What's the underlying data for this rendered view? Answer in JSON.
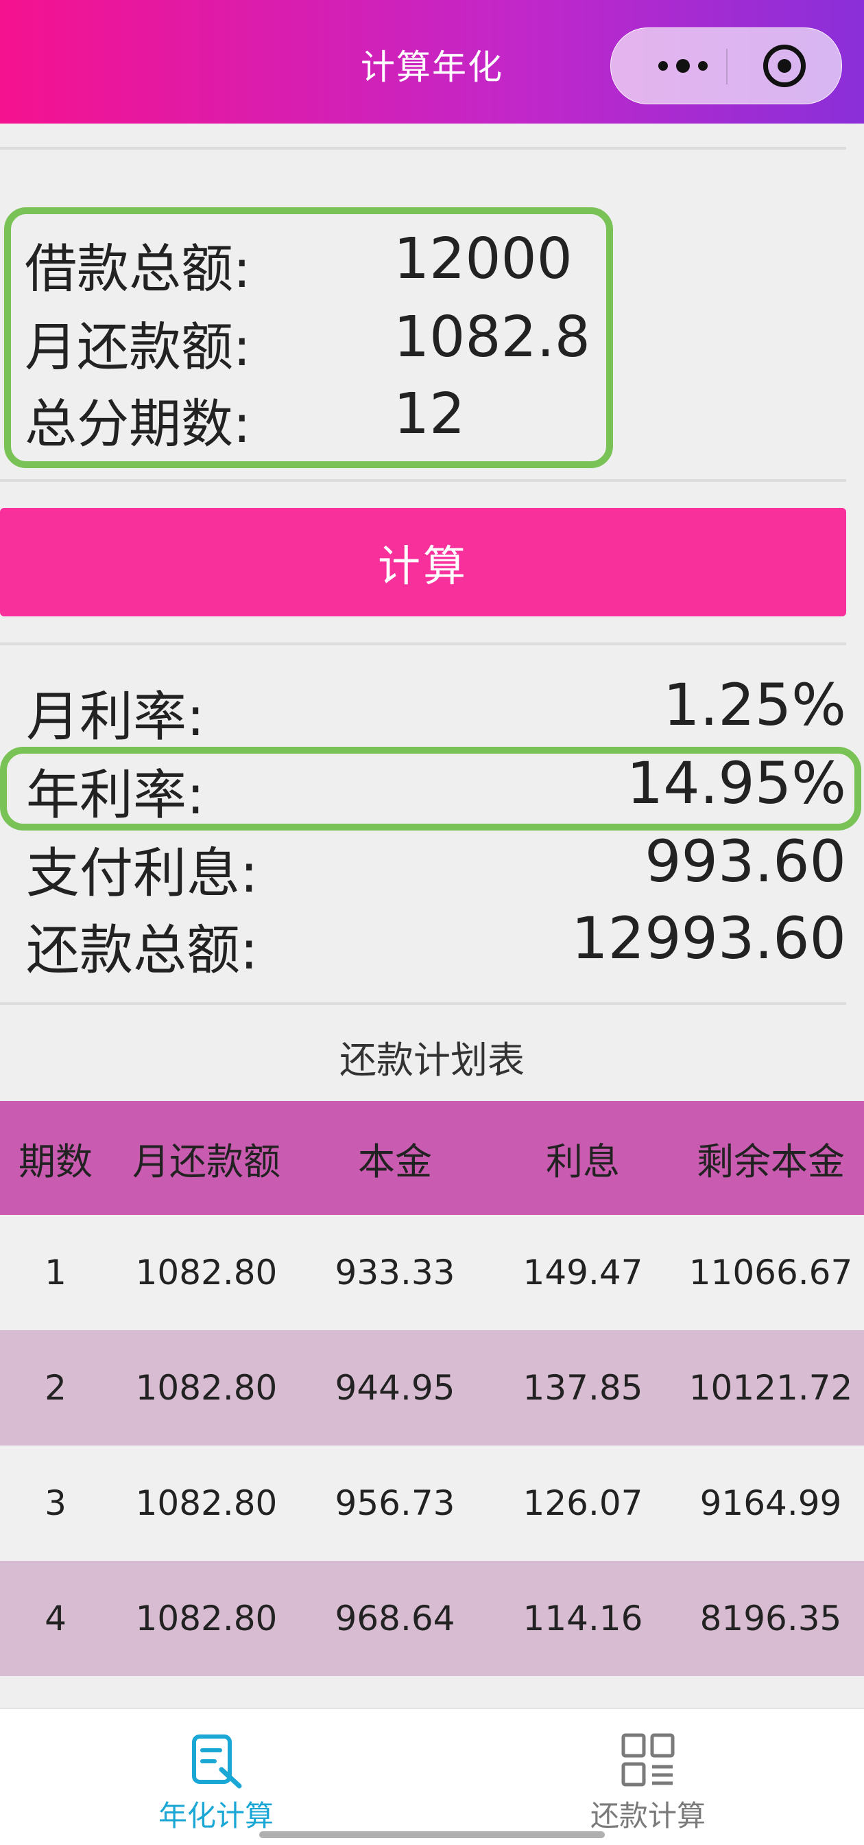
{
  "header": {
    "title": "计算年化"
  },
  "inputs": [
    {
      "label": "借款总额:",
      "value": "12000"
    },
    {
      "label": "月还款额:",
      "value": "1082.8"
    },
    {
      "label": "总分期数:",
      "value": "12"
    }
  ],
  "button": {
    "label": "计算"
  },
  "results": [
    {
      "label": "月利率:",
      "value": "1.25%"
    },
    {
      "label": "年利率:",
      "value": "14.95%"
    },
    {
      "label": "支付利息:",
      "value": "993.60"
    },
    {
      "label": "还款总额:",
      "value": "12993.60"
    }
  ],
  "table": {
    "title": "还款计划表",
    "headers": [
      "期数",
      "月还款额",
      "本金",
      "利息",
      "剩余本金"
    ],
    "rows": [
      [
        "1",
        "1082.80",
        "933.33",
        "149.47",
        "11066.67"
      ],
      [
        "2",
        "1082.80",
        "944.95",
        "137.85",
        "10121.72"
      ],
      [
        "3",
        "1082.80",
        "956.73",
        "126.07",
        "9164.99"
      ],
      [
        "4",
        "1082.80",
        "968.64",
        "114.16",
        "8196.35"
      ]
    ]
  },
  "tabs": [
    {
      "label": "年化计算",
      "icon": "edit-document-icon",
      "color": "#1aa7d6",
      "active": true
    },
    {
      "label": "还款计算",
      "icon": "grid-icon",
      "color": "#7a7a7a",
      "active": false
    }
  ],
  "colors": {
    "header_gradient": [
      "#f5128f",
      "#8a2fd9"
    ],
    "button": "#f7309c",
    "table_header": "#c95bb0",
    "table_alt_row": "#d8bcd2",
    "highlight_border": "#79c255",
    "active_tab": "#1aa7d6"
  }
}
